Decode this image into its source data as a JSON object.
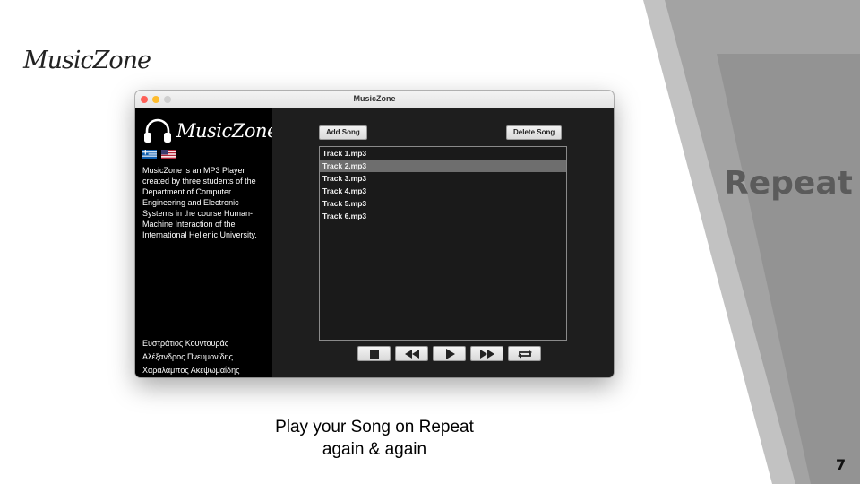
{
  "slide": {
    "logo": "MusicZone",
    "section_title": "Repeat",
    "caption_line1": "Play your Song on Repeat",
    "caption_line2": "again & again",
    "page_number": "7",
    "band_colors": {
      "light": "#bfbfbf",
      "mid": "#9a9a9a",
      "dark": "#6f6f6f"
    }
  },
  "window": {
    "title": "MusicZone",
    "sidebar": {
      "app_title": "MusicZone",
      "logo_icon": "headphones-icon",
      "flags": [
        "greece-flag-icon",
        "usa-flag-icon"
      ],
      "about": "MusicZone is an MP3 Player created by three students of the Department of Computer Engineering and Electronic Systems in the course Human-Machine Interaction of the International Hellenic University.",
      "authors": [
        "Ευστράτιος Κουντουράς",
        "Αλέξανδρος Πνευμονίδης",
        "Χαράλαμπος Ακεψωμαΐδης"
      ]
    },
    "toolbar": {
      "add_label": "Add Song",
      "delete_label": "Delete Song"
    },
    "tracks": [
      {
        "name": "Track 1.mp3",
        "selected": false
      },
      {
        "name": "Track 2.mp3",
        "selected": true
      },
      {
        "name": "Track 3.mp3",
        "selected": false
      },
      {
        "name": "Track 4.mp3",
        "selected": false
      },
      {
        "name": "Track 5.mp3",
        "selected": false
      },
      {
        "name": "Track 6.mp3",
        "selected": false
      }
    ],
    "controls": [
      "stop-icon",
      "rewind-icon",
      "play-icon",
      "fast-forward-icon",
      "repeat-icon"
    ],
    "colors": {
      "window_bg": "#1e1e1e",
      "sidebar_bg": "#000000",
      "selected_row": "#6e6e6e"
    }
  }
}
